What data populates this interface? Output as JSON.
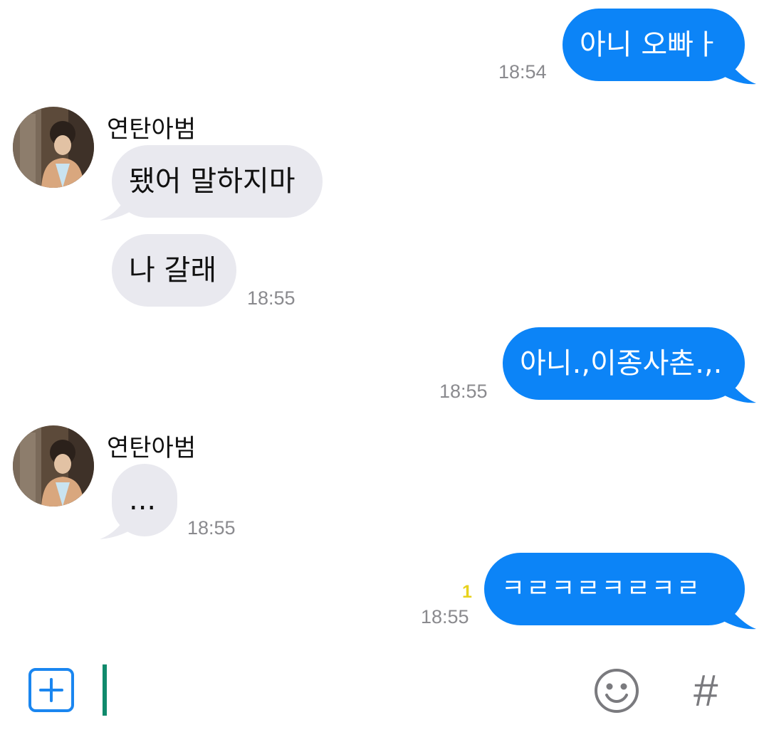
{
  "colors": {
    "outgoing_bubble": "#0c84f7",
    "incoming_bubble": "#e9e9ef",
    "timestamp": "#8a8a8e",
    "unread_marker": "#e8d21c",
    "caret": "#0f8a6c",
    "plus_button": "#1a86f0"
  },
  "messages": [
    {
      "direction": "outgoing",
      "text": "아니 오빠ㅏ",
      "time": "18:54"
    },
    {
      "direction": "incoming",
      "sender": "연탄아범",
      "text": "됐어 말하지마"
    },
    {
      "direction": "incoming",
      "text": "나 갈래",
      "time": "18:55"
    },
    {
      "direction": "outgoing",
      "text": "아니.,이종사촌.,.",
      "time": "18:55"
    },
    {
      "direction": "incoming",
      "sender": "연탄아범",
      "text": "...",
      "time": "18:55"
    },
    {
      "direction": "outgoing",
      "text": "ㅋㄹㅋㄹㅋㄹㅋㄹ",
      "time": "18:55",
      "unread": "1"
    }
  ],
  "composer": {
    "add_icon": "plus-square-icon",
    "emoji_icon": "smiley-icon",
    "hashtag_icon": "hash-icon",
    "hashtag_label": "#"
  }
}
